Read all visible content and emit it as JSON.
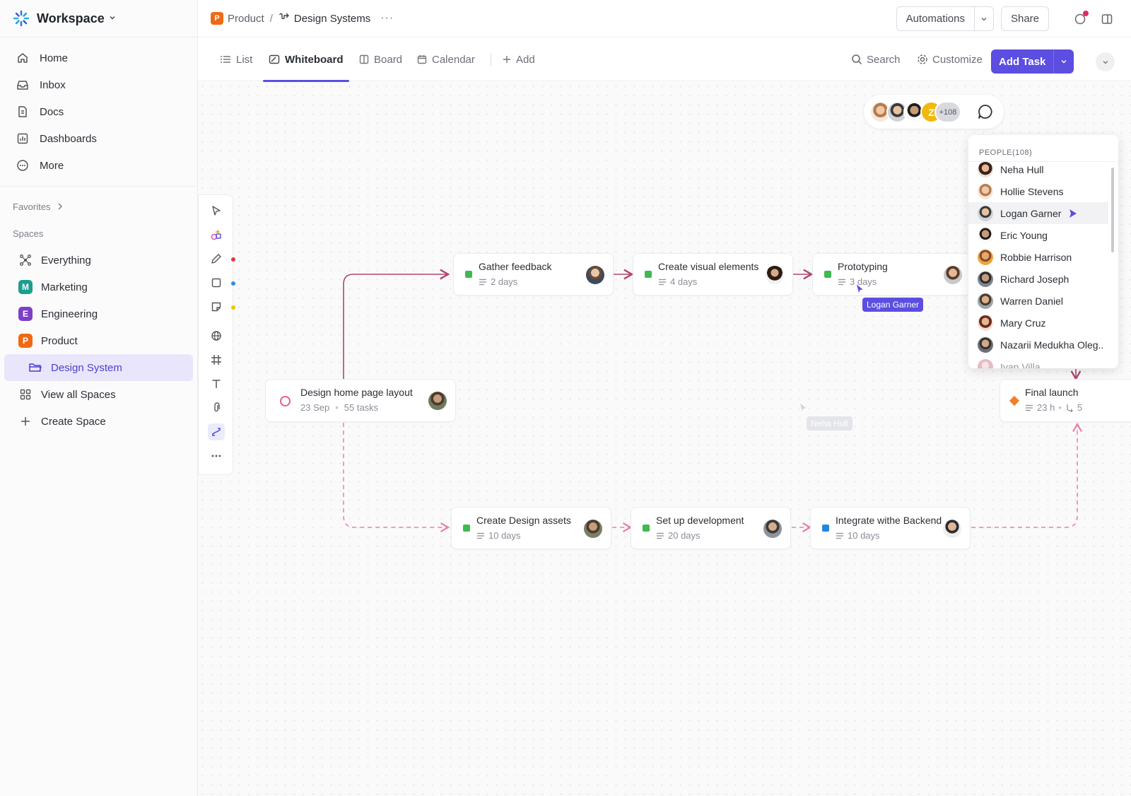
{
  "workspace": {
    "name": "Workspace"
  },
  "nav": [
    {
      "label": "Home",
      "icon": "home-icon"
    },
    {
      "label": "Inbox",
      "icon": "inbox-icon"
    },
    {
      "label": "Docs",
      "icon": "docs-icon"
    },
    {
      "label": "Dashboards",
      "icon": "dashboards-icon"
    },
    {
      "label": "More",
      "icon": "more-icon"
    }
  ],
  "favorites_label": "Favorites",
  "spaces_label": "Spaces",
  "spaces": [
    {
      "label": "Everything",
      "icon": "everything-icon"
    },
    {
      "label": "Marketing",
      "badge": "M",
      "color": "#1a9e8f"
    },
    {
      "label": "Engineering",
      "badge": "E",
      "color": "#7b3fc8"
    },
    {
      "label": "Product",
      "badge": "P",
      "color": "#f06a13"
    },
    {
      "label": "Design System",
      "icon": "folder-icon",
      "active": true
    },
    {
      "label": "View all Spaces",
      "icon": "grid-icon"
    },
    {
      "label": "Create Space",
      "icon": "plus-icon"
    }
  ],
  "breadcrumb": {
    "badge": "P",
    "parent": "Product",
    "separator": "/",
    "current": "Design Systems",
    "more": "···"
  },
  "header": {
    "automations": "Automations",
    "share": "Share"
  },
  "tabs": [
    {
      "label": "List",
      "icon": "list-icon"
    },
    {
      "label": "Whiteboard",
      "icon": "whiteboard-icon",
      "active": true
    },
    {
      "label": "Board",
      "icon": "board-icon"
    },
    {
      "label": "Calendar",
      "icon": "calendar-icon"
    },
    {
      "label": "Add",
      "icon": "plus-icon"
    }
  ],
  "toolbar_right": {
    "search": "Search",
    "customize": "Customize",
    "add_task": "Add Task"
  },
  "presence": {
    "letter": "Z",
    "more": "+108"
  },
  "people": {
    "header": "PEOPLE(108)",
    "list": [
      "Neha Hull",
      "Hollie Stevens",
      "Logan Garner",
      "Eric Young",
      "Robbie Harrison",
      "Richard Joseph",
      "Warren Daniel",
      "Mary Cruz",
      "Nazarii Medukha Oleg..",
      "Ivan Villa"
    ],
    "highlighted": "Logan Garner"
  },
  "cards": [
    {
      "id": "gather",
      "title": "Gather feedback",
      "sub": "2 days",
      "status_color": "#3fb950"
    },
    {
      "id": "visual",
      "title": "Create visual elements",
      "sub": "4 days",
      "status_color": "#3fb950"
    },
    {
      "id": "proto",
      "title": "Prototyping",
      "sub": "3 days",
      "status_color": "#3fb950"
    },
    {
      "id": "home",
      "title": "Design home page layout",
      "date": "23 Sep",
      "dot": "•",
      "tasks": "55 tasks"
    },
    {
      "id": "final",
      "title": "Final launch",
      "hours": "23 h",
      "dot": "•",
      "count": "5",
      "status_color": "#f07e2a"
    },
    {
      "id": "assets",
      "title": "Create Design assets",
      "sub": "10 days",
      "status_color": "#3fb950"
    },
    {
      "id": "dev",
      "title": "Set up development",
      "sub": "20 days",
      "status_color": "#3fb950"
    },
    {
      "id": "backend",
      "title": "Integrate withe Backend",
      "sub": "10 days",
      "status_color": "#1e88e5"
    }
  ],
  "cursors": {
    "logan": "Logan Garner",
    "neha": "Neha Hull"
  },
  "colors": {
    "accent": "#5b4ee0",
    "connector_solid": "#b0466e",
    "connector_dashed": "#ec7fa5"
  }
}
